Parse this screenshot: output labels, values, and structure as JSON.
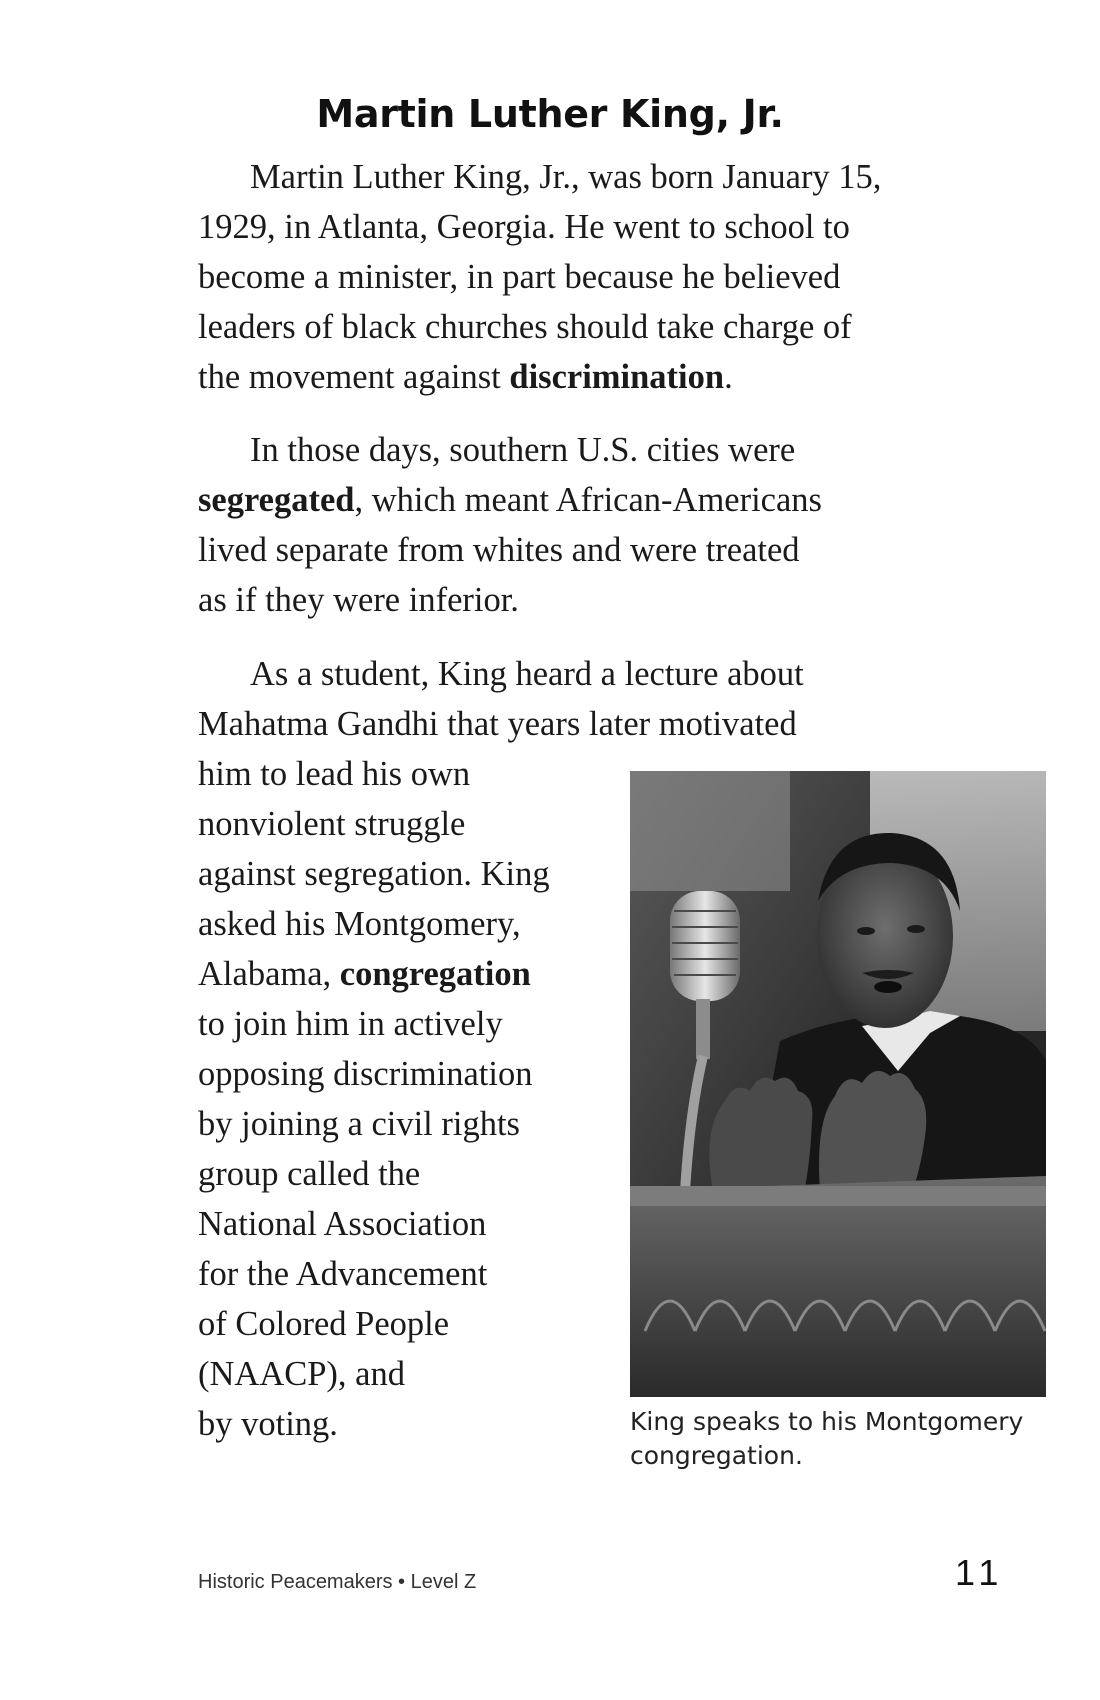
{
  "page": {
    "title": "Martin Luther King, Jr.",
    "footer": "Historic Peacemakers • Level Z",
    "page_number": "11"
  },
  "paragraphs": [
    {
      "lines": [
        [
          {
            "t": "Martin Luther King, Jr., was born January 15,"
          }
        ],
        [
          {
            "t": "1929, in Atlanta, Georgia. He went to school to"
          }
        ],
        [
          {
            "t": "become a minister, in part because he believed"
          }
        ],
        [
          {
            "t": "leaders of black churches should take charge of"
          }
        ],
        [
          {
            "t": "the movement against "
          },
          {
            "t": "discrimination",
            "b": true
          },
          {
            "t": "."
          }
        ]
      ]
    },
    {
      "lines": [
        [
          {
            "t": "In those days, southern U.S. cities were"
          }
        ],
        [
          {
            "t": "segregated",
            "b": true
          },
          {
            "t": ", which meant African-Americans"
          }
        ],
        [
          {
            "t": "lived separate from whites and were treated"
          }
        ],
        [
          {
            "t": "as if they were inferior."
          }
        ]
      ]
    },
    {
      "lines": [
        [
          {
            "t": "As a student, King heard a lecture about"
          }
        ],
        [
          {
            "t": "Mahatma Gandhi that years later motivated"
          }
        ],
        [
          {
            "t": "him to lead his own"
          }
        ],
        [
          {
            "t": "nonviolent struggle"
          }
        ],
        [
          {
            "t": "against segregation. King"
          }
        ],
        [
          {
            "t": "asked his Montgomery,"
          }
        ],
        [
          {
            "t": "Alabama, "
          },
          {
            "t": "congregation",
            "b": true
          }
        ],
        [
          {
            "t": "to join him in actively"
          }
        ],
        [
          {
            "t": "opposing discrimination"
          }
        ],
        [
          {
            "t": "by joining a civil rights"
          }
        ],
        [
          {
            "t": "group called the"
          }
        ],
        [
          {
            "t": "National Association"
          }
        ],
        [
          {
            "t": "for the Advancement"
          }
        ],
        [
          {
            "t": "of Colored People"
          }
        ],
        [
          {
            "t": "(NAACP), and"
          }
        ],
        [
          {
            "t": "by voting."
          }
        ]
      ]
    }
  ],
  "photo": {
    "caption_line1": "King speaks to his Montgomery",
    "caption_line2": "congregation."
  }
}
